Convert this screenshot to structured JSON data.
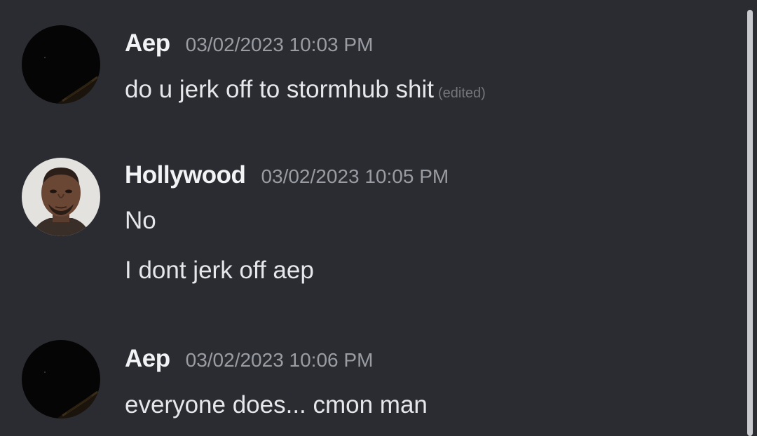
{
  "messages": [
    {
      "username": "Aep",
      "timestamp": "03/02/2023 10:03 PM",
      "avatar": "dark-night-avatar",
      "lines": [
        "do u jerk off to stormhub shit"
      ],
      "edited_label": "(edited)"
    },
    {
      "username": "Hollywood",
      "timestamp": "03/02/2023 10:05 PM",
      "avatar": "mugshot-avatar",
      "lines": [
        "No",
        "I dont jerk off aep"
      ]
    },
    {
      "username": "Aep",
      "timestamp": "03/02/2023 10:06 PM",
      "avatar": "dark-night-avatar",
      "lines": [
        "everyone does... cmon man"
      ]
    }
  ],
  "colors": {
    "background": "#2b2c31",
    "username": "#f2f3f5",
    "timestamp": "#9a9ca3",
    "message_text": "#e6e7ea",
    "edited": "#74767d"
  }
}
